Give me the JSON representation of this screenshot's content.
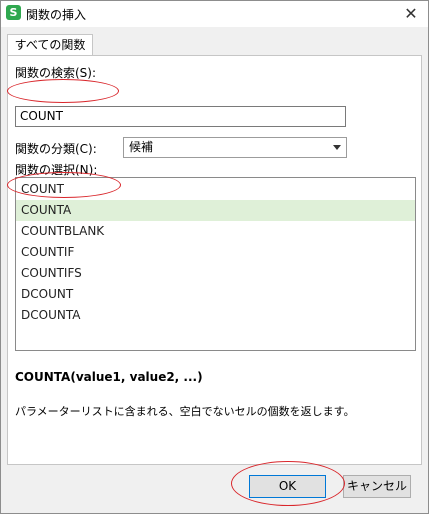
{
  "window": {
    "title": "関数の挿入",
    "app_icon": "S",
    "close_glyph": "✕"
  },
  "tabs": [
    {
      "label": "すべての関数"
    }
  ],
  "search": {
    "label": "関数の検索(S):",
    "value": "COUNT"
  },
  "category": {
    "label": "関数の分類(C):",
    "selected": "候補"
  },
  "function_list": {
    "label": "関数の選択(N):",
    "items": [
      "COUNT",
      "COUNTA",
      "COUNTBLANK",
      "COUNTIF",
      "COUNTIFS",
      "DCOUNT",
      "DCOUNTA"
    ],
    "selected_index": 1
  },
  "function_info": {
    "signature": "COUNTA(value1, value2, ...)",
    "description": "パラメーターリストに含まれる、空白でないセルの個数を返します。"
  },
  "buttons": {
    "ok": "OK",
    "cancel": "キャンセル"
  },
  "colors": {
    "selection": "#dff0d8",
    "annotation": "#d9262b",
    "app_icon": "#2fa84f"
  }
}
